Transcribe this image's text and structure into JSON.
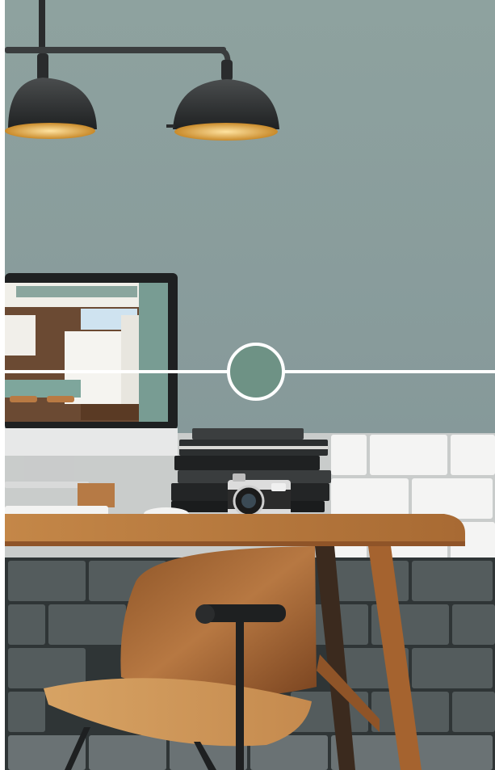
{
  "scene": {
    "description_free": true,
    "colors": {
      "wall": "#8a9f9c",
      "wall_shadow": "#7d938f",
      "tile_light": "#f4f4f3",
      "tile_dark": "#4d5556",
      "grout": "#c9cccb",
      "desk_top": "#b8773f",
      "desk_leg": "#a5632f",
      "chair_wood": "#c98e55",
      "metal": "#2e3030",
      "lamp_glow": "#f2b84a",
      "picker_fill": "#6e9285",
      "picker_ring": "#ffffff"
    },
    "color_picker": {
      "selected_color": "#6e9285"
    }
  }
}
